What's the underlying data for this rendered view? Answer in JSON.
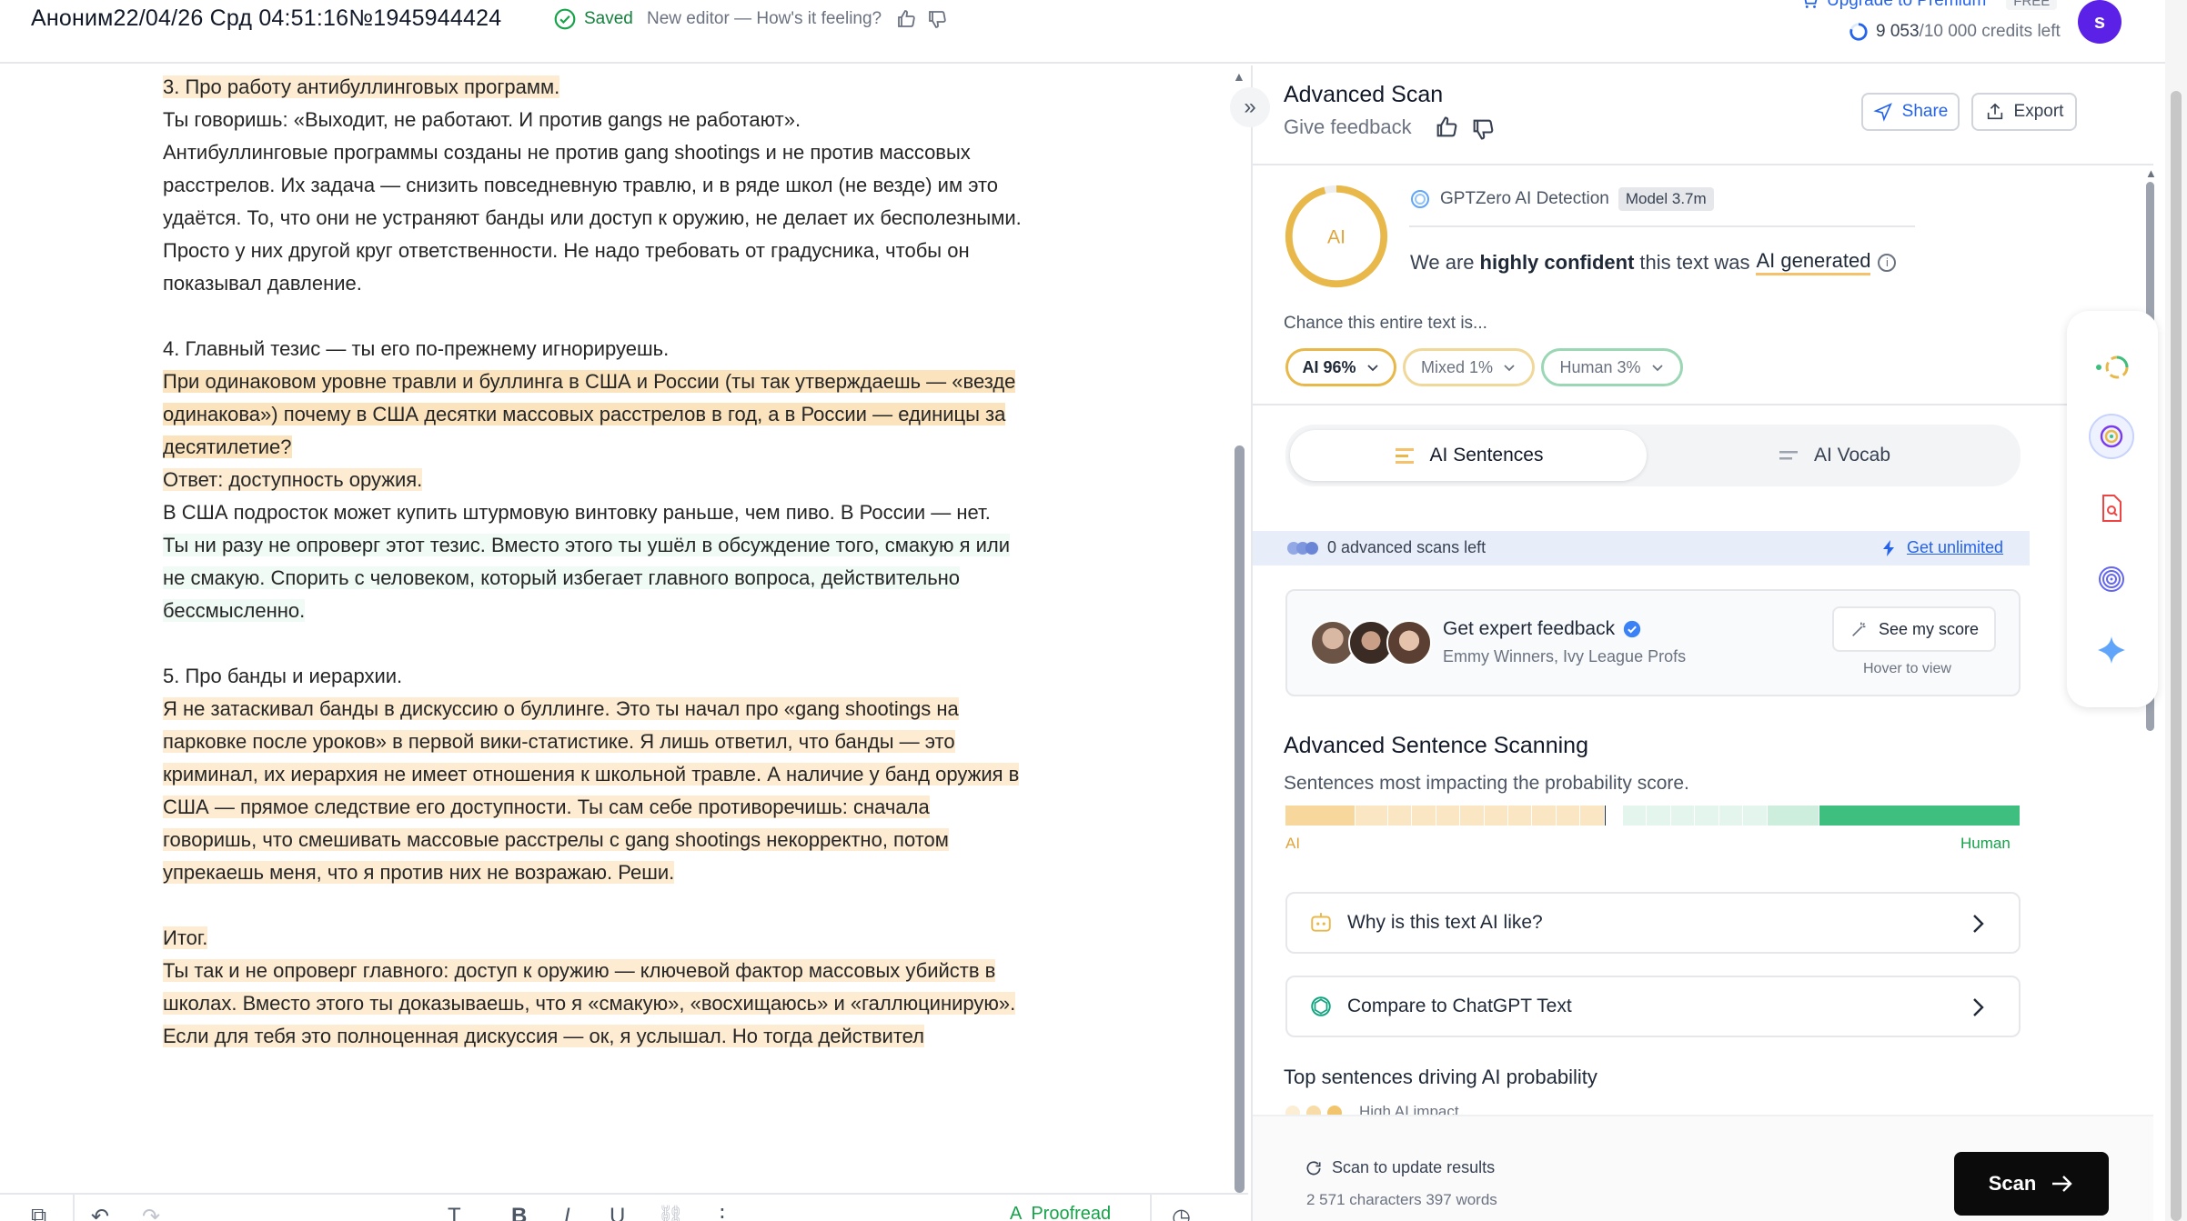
{
  "topbar": {
    "doc_title": "Аноним22/04/26 Срд 04:51:16№1945944424",
    "saved_label": "Saved",
    "editor_feedback": "New editor — How's it feeling?",
    "upgrade_label": "Upgrade to Premium",
    "plan_badge": "FREE",
    "credits_used": "9 053",
    "credits_rest": "/10 000 credits left",
    "avatar_letter": "s"
  },
  "editor": {
    "lines": [
      {
        "text": "3. Про работу антибуллинговых программ.",
        "style": "hl"
      },
      {
        "text": "Ты говоришь: «Выходит, не работают. И против gangs не работают».",
        "style": "none"
      },
      {
        "text": "Антибуллинговые программы созданы не против gang shootings и не против массовых",
        "style": "none"
      },
      {
        "text": "расстрелов. Их задача — снизить повседневную травлю, и в ряде школ (не везде) им это",
        "style": "none"
      },
      {
        "text": "удаётся. То, что они не устраняют банды или доступ к оружию, не делает их бесполезными.",
        "style": "none"
      },
      {
        "text": "Просто у них другой круг ответственности. Не надо требовать от градусника, чтобы он",
        "style": "none"
      },
      {
        "text": "показывал давление.",
        "style": "none"
      },
      {
        "text": "",
        "style": "blank"
      },
      {
        "text": "4. Главный тезис — ты его по-прежнему игнорируешь.",
        "style": "none"
      },
      {
        "text": "При одинаковом уровне травли и буллинга в США и России (ты так утверждаешь — «везде",
        "style": "hl2"
      },
      {
        "text": "одинакова») почему в США десятки массовых расстрелов в год, а в России — единицы за",
        "style": "hl2"
      },
      {
        "text": "десятилетие?",
        "style": "hl2"
      },
      {
        "text": "Ответ: доступность оружия.",
        "style": "hl"
      },
      {
        "text": "В США подросток может купить штурмовую винтовку раньше, чем пиво. В России — нет.",
        "style": "none"
      },
      {
        "text": "Ты ни разу не опроверг этот тезис. Вместо этого ты ушёл в обсуждение того, смакую я или",
        "style": "gr"
      },
      {
        "text": "не смакую. Спорить с человеком, который избегает главного вопроса, действительно",
        "style": "gr"
      },
      {
        "text": "бессмысленно.",
        "style": "gr"
      },
      {
        "text": "",
        "style": "blank"
      },
      {
        "text": "5. Про банды и иерархии.",
        "style": "none"
      },
      {
        "text": "Я не затаскивал банды в дискуссию о буллинге. Это ты начал про «gang shootings на",
        "style": "hl"
      },
      {
        "text": "парковке после уроков» в первой вики-статистике. Я лишь ответил, что банды — это",
        "style": "hl"
      },
      {
        "text": "криминал, их иерархия не имеет отношения к школьной травле. А наличие у банд оружия в",
        "style": "hl"
      },
      {
        "text": "США — прямое следствие его доступности. Ты сам себе противоречишь: сначала",
        "style": "hl"
      },
      {
        "text": "говоришь, что смешивать массовые расстрелы с gang shootings некорректно, потом",
        "style": "hl"
      },
      {
        "text": "упрекаешь меня, что я против них не возражаю. Реши.",
        "style": "hl"
      },
      {
        "text": "",
        "style": "blank"
      },
      {
        "text": "Итог.",
        "style": "hl"
      },
      {
        "text": "Ты так и не опроверг главного: доступ к оружию — ключевой фактор массовых убийств в",
        "style": "hl"
      },
      {
        "text": "школах. Вместо этого ты доказываешь, что я «смакую», «восхищаюсь» и «галлюцинирую».",
        "style": "hl"
      },
      {
        "text": "Если для тебя это полноценная дискуссия — ок, я услышал. Но тогда действител",
        "style": "hl"
      }
    ]
  },
  "toolbar": {
    "text_glyph": "T",
    "bold_glyph": "B",
    "italic_glyph": "I",
    "underline_glyph": "U",
    "more_glyph": "⋮",
    "proofread_label": "Proofread"
  },
  "panel": {
    "title": "Advanced Scan",
    "give_feedback": "Give feedback",
    "share_label": "Share",
    "export_label": "Export",
    "gauge_label": "AI",
    "gauge_ai_fraction": 0.96,
    "detector_label": "GPTZero AI Detection",
    "model_badge": "Model 3.7m",
    "confidence_pre": "We are",
    "confidence_bold": "highly confident",
    "confidence_mid": "this text was",
    "confidence_result": "AI generated",
    "chance_label": "Chance this entire text is...",
    "pills": {
      "ai": "AI 96%",
      "mixed": "Mixed 1%",
      "human": "Human 3%"
    },
    "tabs": {
      "sentences": "AI Sentences",
      "vocab": "AI Vocab"
    },
    "advanced_left": "0 advanced scans left",
    "advanced_right": "Get unlimited",
    "expert": {
      "title": "Get expert feedback",
      "subtitle": "Emmy Winners, Ivy League Profs",
      "button": "See my score",
      "hint": "Hover to view"
    },
    "scanning": {
      "title": "Advanced Sentence Scanning",
      "subtitle": "Sentences most impacting the probability score.",
      "left_label": "AI",
      "right_label": "Human"
    },
    "accordion": {
      "why": "Why is this text AI like?",
      "compare": "Compare to ChatGPT Text"
    },
    "top_sentences": "Top sentences driving AI probability",
    "high_impact": "High AI impact",
    "footer": {
      "scan_update": "Scan to update results",
      "counts": "2 571 characters 397 words",
      "scan_button": "Scan"
    }
  },
  "colors": {
    "ai_yellow": "#e8b94a",
    "human_green": "#3fbf7f",
    "brand_blue": "#2563eb",
    "avatar_purple": "#5b21e6"
  }
}
